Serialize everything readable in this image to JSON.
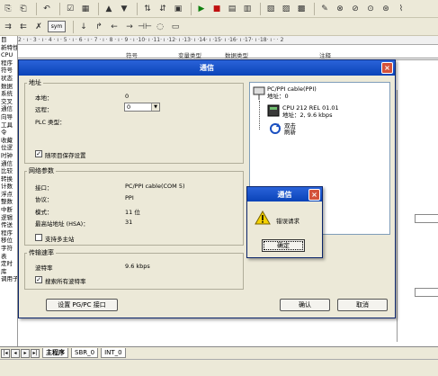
{
  "toolbar2": {
    "sym_label": "sym"
  },
  "tree": {
    "items": [
      "目",
      "新特性",
      "CPU",
      "程序",
      "符号",
      "状态",
      "数据",
      "系统",
      "交叉",
      "通信",
      "向导",
      "工具",
      "令",
      "收藏",
      "位逻",
      "时钟",
      "通信",
      "比较",
      "转换",
      "计数",
      "浮点",
      "整数",
      "中断",
      "逻辑",
      "传送",
      "程序",
      "移位",
      "字符",
      "表",
      "定时",
      "库",
      "调用子程"
    ]
  },
  "ruler_text": "2 · ı · 3 · ı · 4 · ı · 5 · ı · 6 · ı · 7 · ı · 8 · ı · 9 · ı ·10· ı ·11· ı ·12· ı ·13· ı ·14· ı ·15· ı ·16· ı ·17· ı ·18· ı · · 2",
  "editor": {
    "columns": [
      "符号",
      "变量类型",
      "数据类型",
      "注释"
    ]
  },
  "tabs": {
    "items": [
      "主程序",
      "SBR_0",
      "INT_0"
    ],
    "active": "主程序"
  },
  "dialog": {
    "title": "通信",
    "close": "×",
    "address_group": {
      "legend": "地址",
      "local_label": "本地：",
      "local_value": "0",
      "remote_label": "远程：",
      "remote_value": "0",
      "plc_type_label": "PLC 类型：",
      "save_with_project_label": "随项目保存设置",
      "save_with_project_checked": true
    },
    "network_group": {
      "legend": "网络参数",
      "interface_label": "接口：",
      "interface_value": "PC/PPI cable(COM 5)",
      "protocol_label": "协议：",
      "protocol_value": "PPI",
      "mode_label": "模式：",
      "mode_value": "11 位",
      "hsa_label": "最高站地址 (HSA)：",
      "hsa_value": "31",
      "multimaster_label": "支持多主站",
      "multimaster_checked": false
    },
    "baud_group": {
      "legend": "传输速率",
      "baud_label": "波特率",
      "baud_value": "9.6 kbps",
      "search_label": "搜索所有波特率",
      "search_checked": true
    },
    "network_panel": {
      "cable_line1": "PC/PPI cable(PPI)",
      "cable_line2": "地址：0",
      "cpu_line1": "CPU 212 REL 01.01",
      "cpu_line2": "地址：2, 9.6 kbps",
      "refresh_line1": "双击",
      "refresh_line2": "刷新"
    },
    "buttons": {
      "set_interface": "设置 PG/PC 接口",
      "ok": "确认",
      "cancel": "取消"
    }
  },
  "alert": {
    "title": "通信",
    "close": "×",
    "message": "错误请求",
    "ok": "确定"
  },
  "colors": {
    "titlebar": "#0a43b8",
    "close": "#d4513a",
    "background": "#ece9d8"
  }
}
